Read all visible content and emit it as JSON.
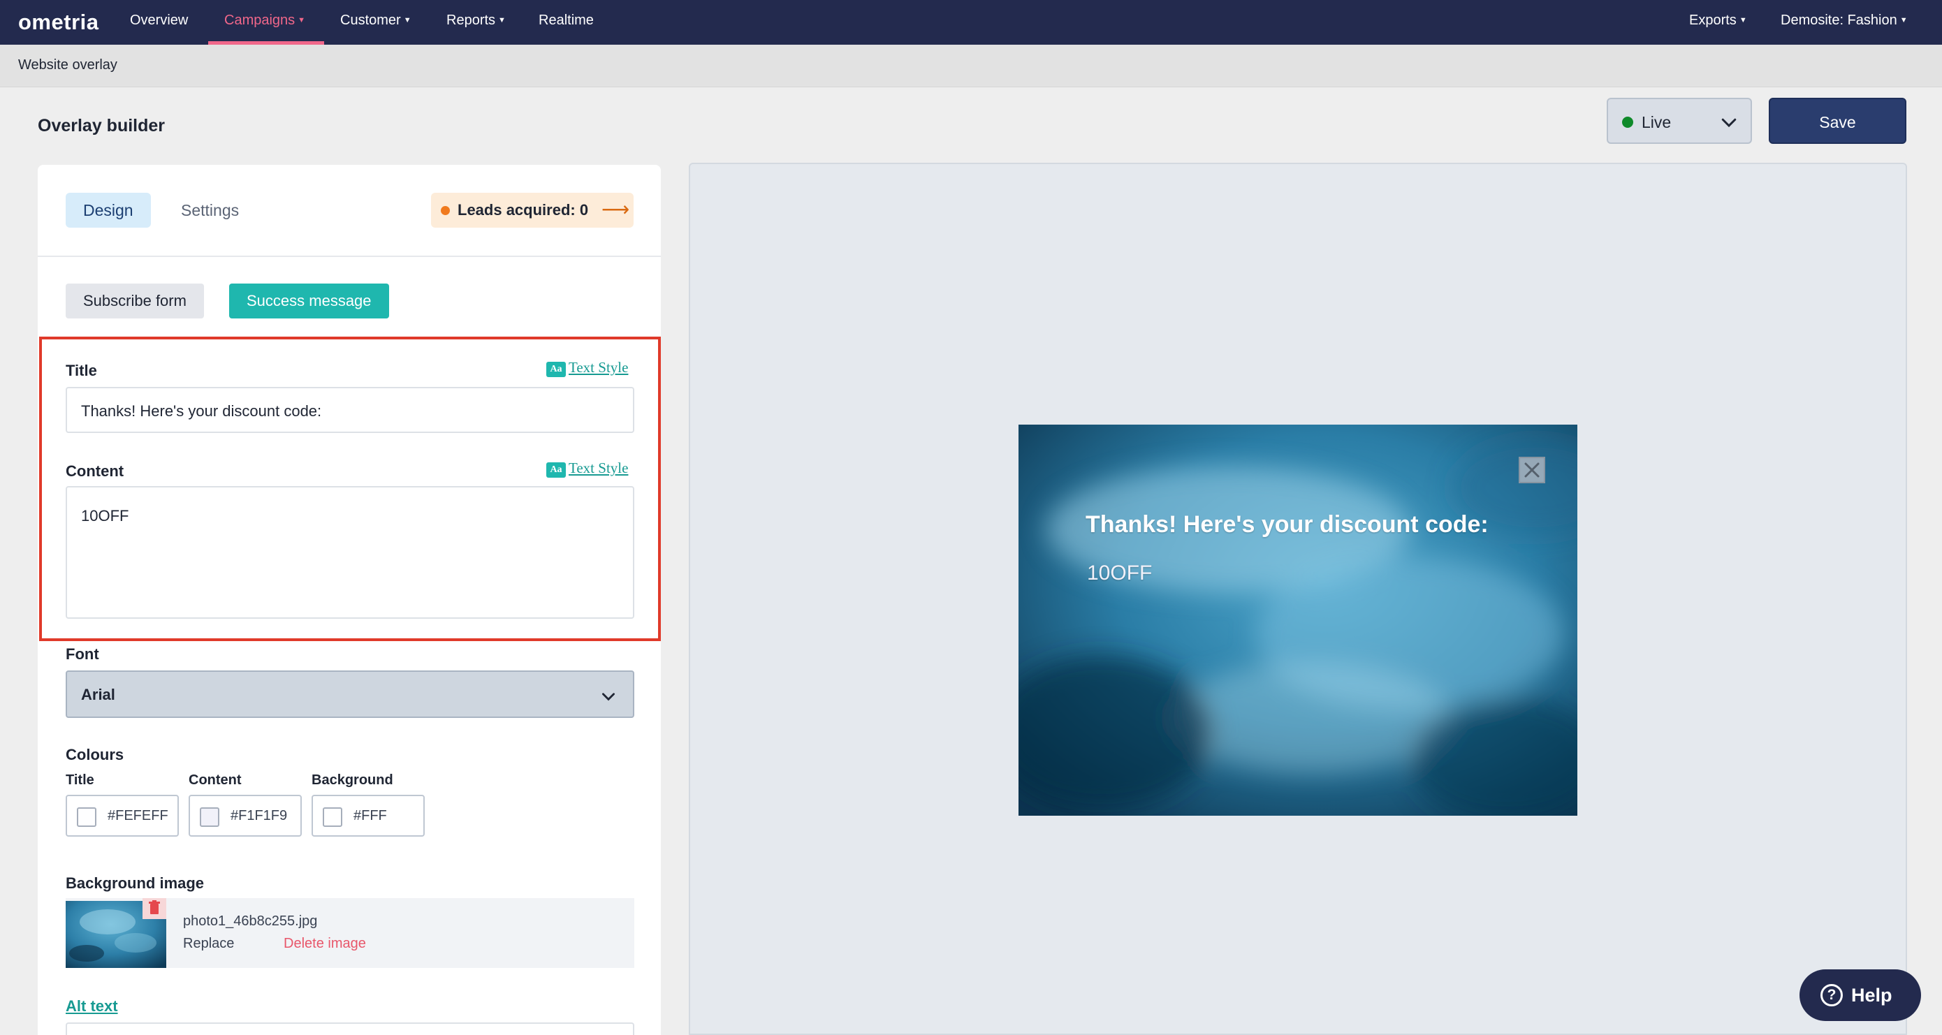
{
  "nav": {
    "logo": "ometria",
    "items": [
      {
        "label": "Overview",
        "has_caret": false,
        "active": false
      },
      {
        "label": "Campaigns",
        "has_caret": true,
        "active": true
      },
      {
        "label": "Customer",
        "has_caret": true,
        "active": false
      },
      {
        "label": "Reports",
        "has_caret": true,
        "active": false
      },
      {
        "label": "Realtime",
        "has_caret": false,
        "active": false
      }
    ],
    "right_items": [
      {
        "label": "Exports",
        "has_caret": true
      },
      {
        "label": "Demosite: Fashion",
        "has_caret": true
      }
    ],
    "active_color": "#f0678a",
    "bg_color": "#232a4e"
  },
  "breadcrumb": "Website overlay",
  "page_title": "Overlay builder",
  "status_select": {
    "value": "Live",
    "dot_color": "#0f8a2a",
    "icon": "chevron-down-icon"
  },
  "save_label": "Save",
  "tabs": [
    {
      "label": "Design",
      "active": true
    },
    {
      "label": "Settings",
      "active": false
    }
  ],
  "leads": {
    "label": "Leads acquired: 0",
    "icon": "arrow-right-icon"
  },
  "segments": [
    {
      "label": "Subscribe form",
      "active": false
    },
    {
      "label": "Success message",
      "active": true
    }
  ],
  "title_field": {
    "label": "Title",
    "value": "Thanks! Here's your discount code:",
    "text_style_label": "Text Style",
    "text_style_icon": "Aa"
  },
  "content_field": {
    "label": "Content",
    "value": "10OFF",
    "text_style_label": "Text Style",
    "text_style_icon": "Aa"
  },
  "font": {
    "label": "Font",
    "value": "Arial",
    "icon": "chevron-down-icon"
  },
  "colours": {
    "label": "Colours",
    "items": [
      {
        "label": "Title",
        "value": "#FEFEFF",
        "swatch": "#fefeff"
      },
      {
        "label": "Content",
        "value": "#F1F1F9",
        "swatch": "#f1f1f9"
      },
      {
        "label": "Background",
        "value": "#FFF",
        "swatch": "#ffffff"
      }
    ]
  },
  "background_image": {
    "label": "Background image",
    "file_name": "photo1_46b8c255.jpg",
    "replace_label": "Replace",
    "delete_label": "Delete image",
    "delete_icon": "trash-icon"
  },
  "alt_text_label": "Alt text",
  "preview": {
    "title": "Thanks! Here's your discount code:",
    "content": "10OFF",
    "close_icon": "close-icon"
  },
  "help_label": "Help",
  "help_icon": "question-mark-icon",
  "accent_color": "#1fb7ae"
}
